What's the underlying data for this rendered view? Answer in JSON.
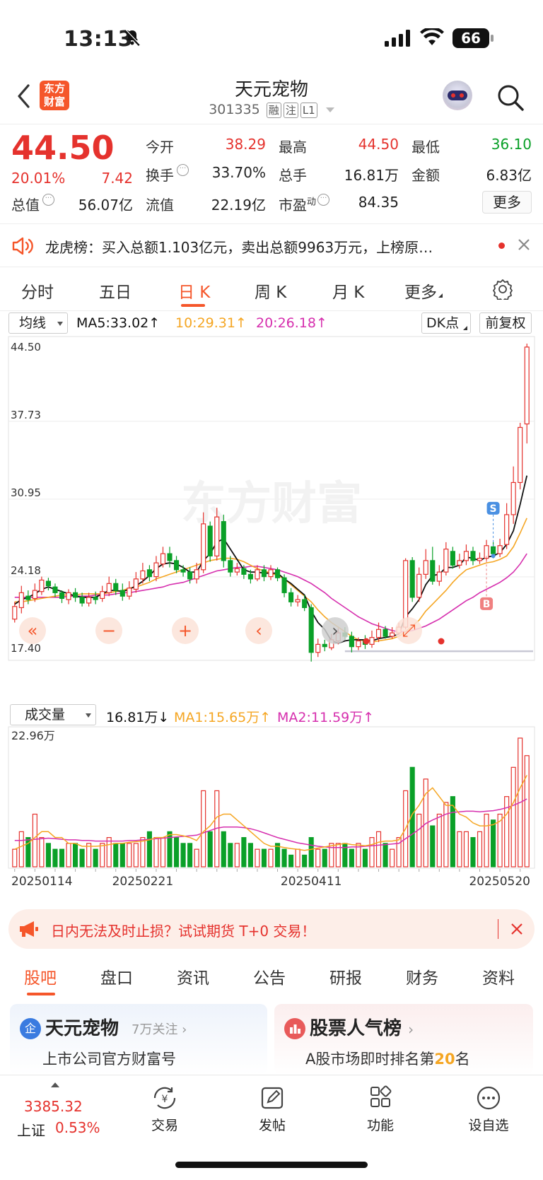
{
  "status_bar": {
    "time": "13:13",
    "battery": "66"
  },
  "header": {
    "back_icon": "chevron-left-icon",
    "logo_text": "东方财富",
    "stock_name": "天元宠物",
    "code": "301335",
    "tags": [
      "融",
      "注",
      "L1"
    ]
  },
  "quote": {
    "price": "44.50",
    "change_pct": "20.01%",
    "change": "7.42",
    "labels": {
      "open": "今开",
      "high": "最高",
      "low": "最低",
      "turnover": "换手",
      "volume": "总手",
      "amount": "金额",
      "mktcap": "总值",
      "float": "流值",
      "pe": "市盈",
      "pe_sup": "动"
    },
    "values": {
      "open": "38.29",
      "high": "44.50",
      "low": "36.10",
      "turnover": "33.70%",
      "volume": "16.81万",
      "amount": "6.83亿",
      "mktcap": "56.07亿",
      "float": "22.19亿",
      "pe": "84.35"
    },
    "more": "更多"
  },
  "notice": {
    "text": "龙虎榜：买入总额1.103亿元，卖出总额9963万元，上榜原…"
  },
  "tabs": [
    "分时",
    "五日",
    "日 K",
    "周 K",
    "月 K",
    "更多"
  ],
  "active_tab": 2,
  "toolbar": {
    "ma_select": "均线",
    "ma5": "MA5:33.02",
    "ma10": "10:29.31",
    "ma20": "20:26.18",
    "dk": "DK点",
    "fq": "前复权"
  },
  "chart_labels": {
    "watermark": "东方财富"
  },
  "vol_toolbar": {
    "select": "成交量",
    "vol": "16.81万",
    "ma1": "MA1:15.65万",
    "ma2": "MA2:11.59万",
    "max": "22.96万"
  },
  "colors": {
    "up": "#e5322d",
    "down": "#0aa028",
    "ma5": "#111111",
    "ma10": "#f5a623",
    "ma20": "#d62fae",
    "accent": "#f5562a"
  },
  "chart_data": {
    "type": "candlestick",
    "y_ticks": [
      "44.50",
      "37.73",
      "30.95",
      "24.18",
      "17.40"
    ],
    "ylim": [
      17.4,
      44.5
    ],
    "x_ticks": [
      "20250114",
      "20250221",
      "20250411",
      "20250520"
    ],
    "markers": {
      "sell": "S",
      "buy": "B"
    },
    "candles": [
      [
        20.5,
        21.6,
        20.2,
        22.0
      ],
      [
        21.5,
        22.8,
        21.0,
        23.4
      ],
      [
        22.5,
        22.2,
        21.8,
        23.0
      ],
      [
        22.3,
        23.0,
        22.0,
        23.6
      ],
      [
        22.9,
        23.9,
        22.6,
        24.2
      ],
      [
        23.8,
        23.4,
        23.0,
        24.1
      ],
      [
        23.3,
        22.8,
        22.4,
        23.6
      ],
      [
        22.8,
        22.3,
        21.9,
        23.0
      ],
      [
        22.2,
        22.8,
        21.8,
        23.1
      ],
      [
        22.8,
        22.4,
        22.0,
        23.2
      ],
      [
        22.4,
        21.9,
        21.6,
        22.8
      ],
      [
        21.9,
        22.4,
        21.6,
        22.8
      ],
      [
        22.4,
        22.2,
        21.8,
        22.9
      ],
      [
        22.3,
        22.9,
        22.0,
        23.4
      ],
      [
        22.8,
        23.6,
        22.5,
        24.2
      ],
      [
        23.6,
        23.0,
        22.6,
        24.0
      ],
      [
        23.0,
        22.5,
        22.1,
        23.6
      ],
      [
        22.5,
        23.2,
        22.2,
        23.8
      ],
      [
        23.1,
        24.0,
        22.8,
        24.6
      ],
      [
        24.0,
        24.7,
        23.6,
        25.4
      ],
      [
        24.8,
        24.2,
        23.8,
        25.2
      ],
      [
        24.2,
        25.4,
        23.8,
        26.0
      ],
      [
        25.3,
        26.2,
        25.0,
        26.8
      ],
      [
        26.2,
        25.6,
        25.0,
        26.8
      ],
      [
        25.6,
        24.8,
        24.5,
        26.0
      ],
      [
        24.8,
        24.6,
        24.2,
        25.2
      ],
      [
        24.6,
        24.0,
        23.6,
        25.0
      ],
      [
        24.0,
        24.8,
        23.6,
        25.4
      ],
      [
        24.8,
        28.8,
        24.5,
        29.8
      ],
      [
        28.6,
        26.0,
        25.5,
        29.0
      ],
      [
        26.0,
        29.4,
        25.6,
        30.2
      ],
      [
        29.0,
        25.6,
        25.0,
        29.6
      ],
      [
        25.6,
        24.6,
        24.2,
        26.0
      ],
      [
        24.6,
        24.9,
        24.3,
        25.4
      ],
      [
        24.9,
        24.4,
        24.0,
        25.2
      ],
      [
        24.4,
        24.0,
        23.6,
        24.8
      ],
      [
        24.0,
        24.8,
        23.8,
        25.2
      ],
      [
        24.8,
        24.2,
        23.8,
        25.2
      ],
      [
        24.2,
        24.8,
        23.9,
        25.2
      ],
      [
        24.8,
        24.1,
        23.8,
        25.0
      ],
      [
        24.1,
        22.8,
        22.4,
        24.4
      ],
      [
        22.8,
        22.0,
        21.6,
        23.2
      ],
      [
        22.0,
        22.2,
        21.6,
        22.6
      ],
      [
        22.2,
        21.5,
        21.2,
        22.6
      ],
      [
        21.5,
        17.6,
        16.8,
        21.8
      ],
      [
        17.6,
        18.3,
        17.2,
        18.8
      ],
      [
        18.3,
        18.1,
        17.7,
        18.7
      ],
      [
        18.0,
        18.7,
        17.8,
        19.2
      ],
      [
        18.6,
        19.3,
        18.3,
        19.7
      ],
      [
        19.3,
        19.0,
        18.7,
        19.8
      ],
      [
        19.0,
        18.1,
        17.6,
        19.4
      ],
      [
        18.1,
        18.6,
        17.8,
        18.9
      ],
      [
        18.6,
        18.3,
        17.9,
        19.1
      ],
      [
        18.3,
        18.9,
        18.0,
        19.5
      ],
      [
        18.9,
        19.6,
        18.5,
        20.2
      ],
      [
        19.6,
        19.0,
        18.8,
        19.9
      ],
      [
        19.0,
        19.3,
        18.8,
        19.8
      ],
      [
        19.3,
        19.8,
        19.1,
        20.2
      ],
      [
        19.8,
        25.6,
        19.6,
        25.8
      ],
      [
        25.6,
        22.4,
        22.0,
        25.9
      ],
      [
        22.4,
        24.4,
        22.0,
        25.0
      ],
      [
        24.4,
        25.6,
        24.0,
        26.6
      ],
      [
        25.6,
        23.8,
        23.5,
        26.8
      ],
      [
        23.8,
        24.6,
        23.4,
        25.2
      ],
      [
        24.6,
        26.6,
        24.3,
        27.2
      ],
      [
        26.4,
        25.2,
        24.9,
        26.8
      ],
      [
        25.2,
        25.6,
        24.9,
        26.2
      ],
      [
        25.6,
        26.4,
        25.2,
        27.0
      ],
      [
        26.4,
        25.6,
        25.2,
        26.8
      ],
      [
        25.6,
        25.8,
        25.3,
        26.3
      ],
      [
        25.8,
        26.9,
        25.5,
        27.4
      ],
      [
        26.8,
        26.2,
        25.8,
        27.2
      ],
      [
        26.2,
        26.9,
        25.9,
        27.5
      ],
      [
        27.0,
        29.6,
        26.6,
        30.6
      ],
      [
        29.6,
        32.4,
        28.8,
        33.8
      ],
      [
        32.4,
        37.2,
        31.8,
        37.6
      ],
      [
        37.5,
        44.2,
        35.8,
        44.5
      ]
    ],
    "ma5": [
      21.8,
      22.2,
      22.4,
      22.7,
      23.1,
      23.3,
      23.1,
      22.9,
      22.7,
      22.5,
      22.4,
      22.4,
      22.4,
      22.7,
      23.0,
      23.0,
      22.9,
      23.1,
      23.4,
      23.8,
      24.3,
      24.9,
      25.3,
      25.4,
      25.3,
      25.0,
      24.6,
      24.6,
      25.6,
      26.2,
      27.2,
      27.5,
      26.6,
      25.7,
      24.8,
      24.6,
      24.6,
      24.5,
      24.5,
      24.5,
      24.0,
      23.6,
      23.1,
      22.6,
      21.2,
      20.2,
      19.6,
      18.6,
      18.4,
      18.6,
      18.7,
      18.7,
      18.7,
      18.6,
      18.8,
      18.9,
      19.0,
      19.2,
      20.7,
      21.4,
      22.2,
      23.5,
      24.3,
      24.4,
      25.0,
      25.0,
      25.2,
      25.9,
      25.8,
      25.6,
      25.9,
      26.0,
      26.3,
      27.0,
      28.2,
      30.5,
      33.0
    ],
    "ma10": [
      22.0,
      22.0,
      22.1,
      22.2,
      22.3,
      22.4,
      22.5,
      22.6,
      22.6,
      22.6,
      22.7,
      22.7,
      22.7,
      22.7,
      22.8,
      22.9,
      23.0,
      23.2,
      23.3,
      23.5,
      23.7,
      24.0,
      24.2,
      24.4,
      24.6,
      24.8,
      25.0,
      25.2,
      25.4,
      25.6,
      25.7,
      25.8,
      25.8,
      25.7,
      25.5,
      25.2,
      24.9,
      24.7,
      24.5,
      24.3,
      24.0,
      23.5,
      23.0,
      22.5,
      22.0,
      21.3,
      20.7,
      20.2,
      19.8,
      19.4,
      19.0,
      18.7,
      18.6,
      18.5,
      18.6,
      18.7,
      18.8,
      19.0,
      19.4,
      19.9,
      20.4,
      21.2,
      21.8,
      22.4,
      23.0,
      23.7,
      24.3,
      24.8,
      25.0,
      25.2,
      25.4,
      25.5,
      25.7,
      26.0,
      26.8,
      28.0,
      29.3
    ],
    "ma20": [
      22.4,
      22.4,
      22.4,
      22.4,
      22.4,
      22.4,
      22.4,
      22.4,
      22.5,
      22.5,
      22.5,
      22.5,
      22.6,
      22.6,
      22.6,
      22.7,
      22.8,
      22.8,
      22.9,
      23.0,
      23.1,
      23.2,
      23.3,
      23.5,
      23.6,
      23.7,
      23.9,
      24.1,
      24.3,
      24.5,
      24.7,
      24.8,
      24.9,
      25.0,
      25.0,
      25.1,
      25.1,
      25.0,
      24.9,
      24.8,
      24.6,
      24.4,
      24.2,
      23.9,
      23.6,
      23.2,
      22.8,
      22.3,
      21.9,
      21.5,
      21.1,
      20.7,
      20.4,
      20.1,
      19.9,
      19.7,
      19.5,
      19.4,
      19.4,
      19.5,
      19.7,
      19.9,
      20.2,
      20.5,
      20.9,
      21.3,
      21.7,
      22.1,
      22.4,
      22.8,
      23.1,
      23.4,
      23.7,
      24.1,
      24.6,
      25.3,
      26.2
    ],
    "volume_max": 22.96,
    "volume": [
      3,
      6,
      5,
      9,
      5,
      4,
      3,
      3,
      4,
      4,
      3,
      4,
      3,
      4,
      5,
      4,
      4,
      4,
      4,
      5,
      6,
      5,
      5,
      6,
      5,
      4,
      4,
      3,
      13,
      6,
      13,
      6,
      4,
      4,
      5,
      4,
      3,
      3,
      3,
      4,
      3,
      2,
      3,
      2,
      5,
      3,
      3,
      4,
      4,
      4,
      3,
      4,
      3,
      5,
      6,
      4,
      3,
      5,
      13,
      17,
      9,
      15,
      7,
      9,
      11,
      12,
      6,
      6,
      5,
      6,
      9,
      8,
      9,
      12,
      17,
      22,
      19
    ],
    "vma1": [
      3,
      3.5,
      4,
      5,
      6,
      6,
      5,
      5,
      4,
      4,
      3.5,
      3.5,
      3.5,
      3.6,
      3.8,
      4,
      4,
      4.2,
      4.3,
      4.4,
      4.6,
      5,
      5,
      5.5,
      5.5,
      5.3,
      5,
      4.5,
      6,
      7,
      8.5,
      9,
      9,
      8,
      7,
      6,
      5,
      4,
      3.5,
      3.5,
      3.3,
      3.1,
      3,
      2.8,
      3,
      3.2,
      3.4,
      3.6,
      3.8,
      4,
      3.8,
      3.7,
      3.6,
      3.8,
      4.2,
      4.4,
      4.4,
      4.6,
      6.5,
      9,
      10.5,
      12.5,
      13.5,
      12,
      10.5,
      10.5,
      9,
      8.5,
      7.5,
      7,
      7,
      7.2,
      7.8,
      9,
      11,
      13.5,
      15.65
    ],
    "vma2": [
      4.5,
      4.5,
      4.6,
      4.7,
      4.8,
      4.9,
      4.8,
      4.7,
      4.6,
      4.6,
      4.5,
      4.5,
      4.4,
      4.4,
      4.4,
      4.4,
      4.4,
      4.5,
      4.5,
      4.6,
      4.7,
      4.8,
      4.9,
      5,
      5.1,
      5.2,
      5.3,
      5.4,
      5.8,
      6.2,
      6.6,
      6.8,
      6.8,
      6.8,
      6.7,
      6.5,
      6.2,
      5.8,
      5.4,
      5,
      4.7,
      4.4,
      4.1,
      3.9,
      3.7,
      3.5,
      3.4,
      3.3,
      3.3,
      3.3,
      3.4,
      3.4,
      3.5,
      3.6,
      3.7,
      3.8,
      3.9,
      4,
      4.8,
      5.6,
      6.4,
      7.4,
      8,
      8.5,
      9,
      9.3,
      9.4,
      9.5,
      9.5,
      9.4,
      9.5,
      9.6,
      9.8,
      10.1,
      10.5,
      11,
      11.59
    ]
  },
  "banner": {
    "text": "日内无法及时止损？试试期货 T+0 交易！"
  },
  "bottom_tabs": [
    "股吧",
    "盘口",
    "资讯",
    "公告",
    "研报",
    "财务",
    "资料"
  ],
  "cards": [
    {
      "title": "天元宠物",
      "sub": "7万关注",
      "desc": "上市公司官方财富号",
      "badge": "企"
    },
    {
      "title": "股票人气榜",
      "desc_pre": "A股市场即时排名第",
      "rank": "20",
      "desc_post": "名"
    }
  ],
  "nav": {
    "index_value": "3385.32",
    "index_name": "上证",
    "index_pct": "0.53%",
    "items": [
      "交易",
      "发帖",
      "功能",
      "设自选"
    ]
  }
}
